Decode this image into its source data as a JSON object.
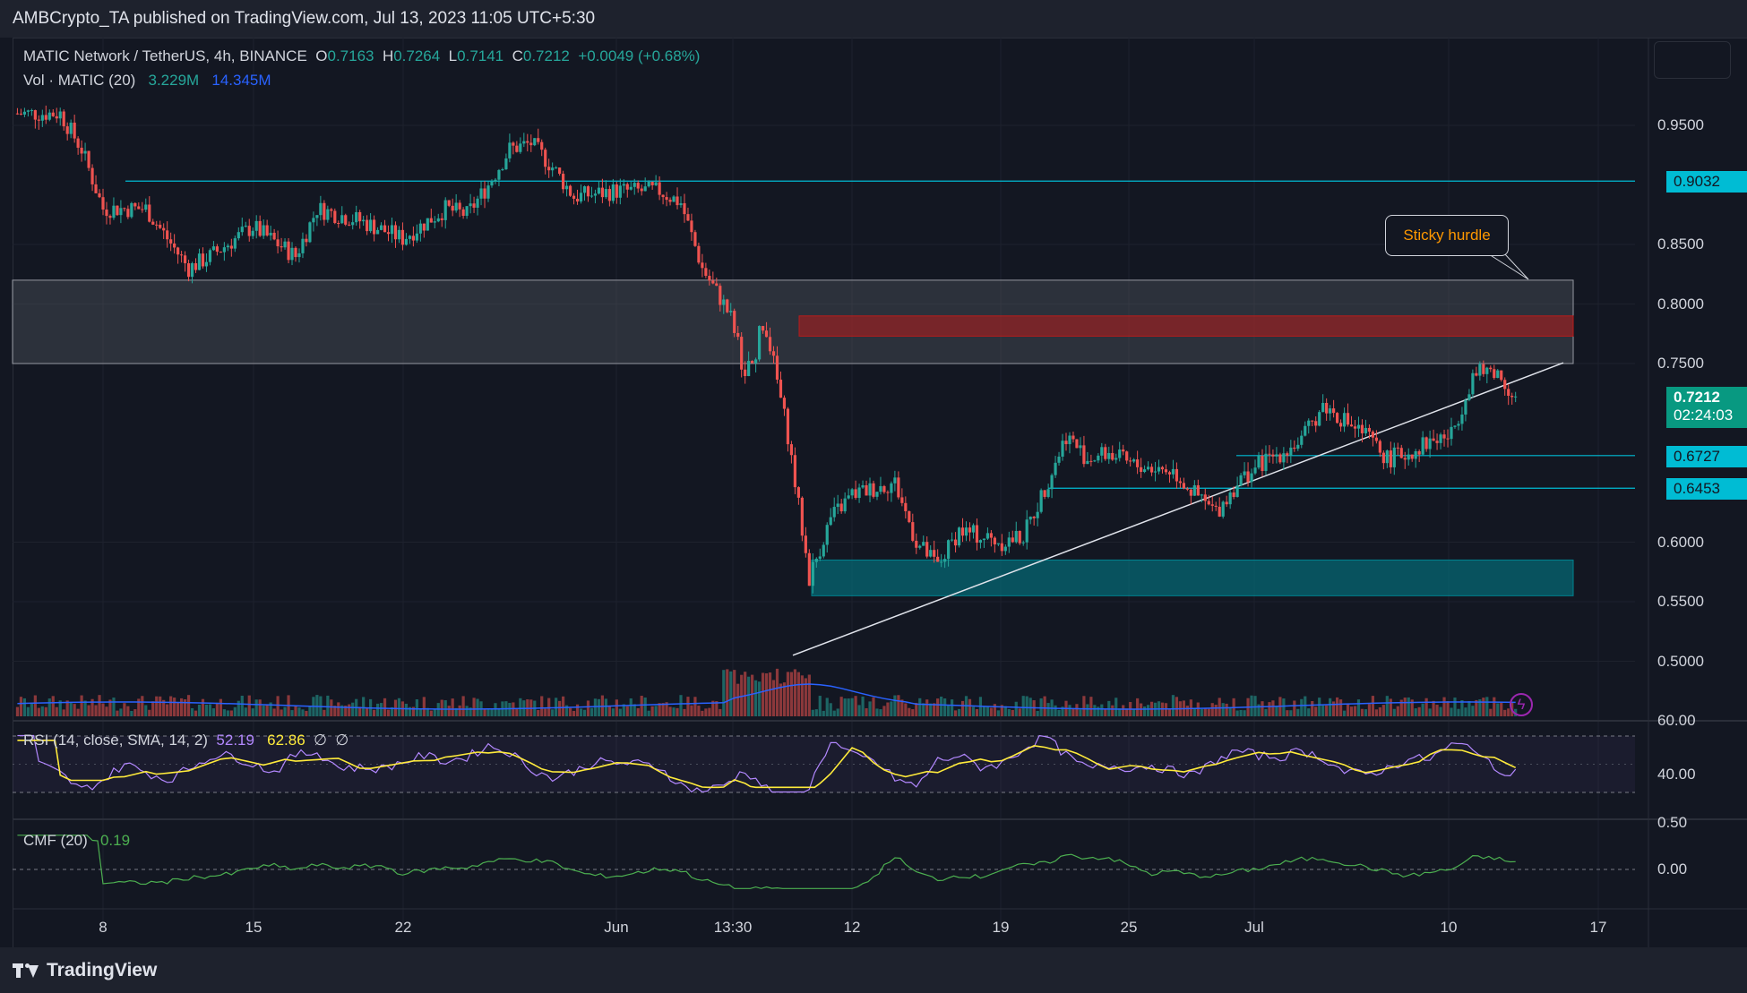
{
  "header": {
    "publisher_text": "AMBCrypto_TA published on TradingView.com, Jul 13, 2023 11:05 UTC+5:30"
  },
  "legend": {
    "symbol": "MATIC Network / TetherUS, 4h, BINANCE",
    "o_label": "O",
    "o_value": "0.7163",
    "h_label": "H",
    "h_value": "0.7264",
    "l_label": "L",
    "l_value": "0.7141",
    "c_label": "C",
    "c_value": "0.7212",
    "change": "+0.0049 (+0.68%)",
    "vol_label": "Vol · MATIC (20)",
    "vol_value": "3.229M",
    "vol_ma": "14.345M",
    "rsi_label": "RSI (14, close, SMA, 14, 2)",
    "rsi_value": "52.19",
    "rsi_sma": "62.86",
    "rsi_extra1": "∅",
    "rsi_extra2": "∅",
    "cmf_label": "CMF (20)",
    "cmf_value": "0.19"
  },
  "price_scale": {
    "ticks": [
      "0.9500",
      "0.8500",
      "0.8000",
      "0.7500",
      "0.6000",
      "0.5500",
      "0.5000"
    ],
    "tags": [
      {
        "text": "0.9032",
        "color": "#00bcd4"
      },
      {
        "text": "0.6727",
        "color": "#00bcd4"
      },
      {
        "text": "0.6453",
        "color": "#00bcd4"
      }
    ],
    "current_price": "0.7212",
    "countdown": "02:24:03",
    "current_color": "#089981"
  },
  "rsi_scale": {
    "ticks": [
      "60.00",
      "40.00"
    ]
  },
  "cmf_scale": {
    "ticks": [
      "0.50",
      "0.00"
    ]
  },
  "time_axis": {
    "labels": [
      "8",
      "15",
      "22",
      "Jun",
      "13:30",
      "12",
      "19",
      "25",
      "Jul",
      "10",
      "17"
    ]
  },
  "annotation": {
    "text": "Sticky hurdle"
  },
  "footer": {
    "brand": "TradingView"
  },
  "chart_data": {
    "type": "candlestick",
    "symbol": "MATICUSDT",
    "timeframe": "4h",
    "ylim": [
      0.48,
      0.98
    ],
    "levels": [
      0.9032,
      0.6727,
      0.6453
    ],
    "zones": [
      {
        "name": "supply",
        "from": 0.75,
        "to": 0.82,
        "color": "#5d606b"
      },
      {
        "name": "order-block",
        "from": 0.773,
        "to": 0.79,
        "color": "#b71c1c"
      },
      {
        "name": "demand",
        "from": 0.555,
        "to": 0.585,
        "color": "#00838f"
      }
    ],
    "trendline": {
      "from": {
        "date": "Jun 9",
        "price": 0.505
      },
      "to": {
        "date": "Jul 12",
        "price": 0.707
      }
    },
    "close_path": [
      {
        "date": "May 4",
        "price": 0.96
      },
      {
        "date": "May 6",
        "price": 0.96
      },
      {
        "date": "May 7",
        "price": 0.93
      },
      {
        "date": "May 8",
        "price": 0.88
      },
      {
        "date": "May 10",
        "price": 0.88
      },
      {
        "date": "May 12",
        "price": 0.83
      },
      {
        "date": "May 13",
        "price": 0.84
      },
      {
        "date": "May 15",
        "price": 0.865
      },
      {
        "date": "May 17",
        "price": 0.84
      },
      {
        "date": "May 18",
        "price": 0.88
      },
      {
        "date": "May 20",
        "price": 0.87
      },
      {
        "date": "May 22",
        "price": 0.855
      },
      {
        "date": "May 24",
        "price": 0.88
      },
      {
        "date": "May 25",
        "price": 0.875
      },
      {
        "date": "May 26",
        "price": 0.9
      },
      {
        "date": "May 27",
        "price": 0.93
      },
      {
        "date": "May 28",
        "price": 0.935
      },
      {
        "date": "May 29",
        "price": 0.915
      },
      {
        "date": "May 30",
        "price": 0.89
      },
      {
        "date": "Jun 1",
        "price": 0.895
      },
      {
        "date": "Jun 3",
        "price": 0.895
      },
      {
        "date": "Jun 4",
        "price": 0.885
      },
      {
        "date": "Jun 5",
        "price": 0.83
      },
      {
        "date": "Jun 6",
        "price": 0.8
      },
      {
        "date": "Jun 7",
        "price": 0.765
      },
      {
        "date": "Jun 8",
        "price": 0.78
      },
      {
        "date": "Jun 9",
        "price": 0.69
      },
      {
        "date": "Jun 10",
        "price": 0.57
      },
      {
        "date": "Jun 11",
        "price": 0.62
      },
      {
        "date": "Jun 12",
        "price": 0.64
      },
      {
        "date": "Jun 14",
        "price": 0.65
      },
      {
        "date": "Jun 15",
        "price": 0.6
      },
      {
        "date": "Jun 16",
        "price": 0.58
      },
      {
        "date": "Jun 17",
        "price": 0.61
      },
      {
        "date": "Jun 19",
        "price": 0.6
      },
      {
        "date": "Jun 20",
        "price": 0.605
      },
      {
        "date": "Jun 21",
        "price": 0.645
      },
      {
        "date": "Jun 22",
        "price": 0.69
      },
      {
        "date": "Jun 23",
        "price": 0.67
      },
      {
        "date": "Jun 24",
        "price": 0.675
      },
      {
        "date": "Jun 25",
        "price": 0.665
      },
      {
        "date": "Jun 27",
        "price": 0.66
      },
      {
        "date": "Jun 28",
        "price": 0.64
      },
      {
        "date": "Jun 29",
        "price": 0.625
      },
      {
        "date": "Jun 30",
        "price": 0.65
      },
      {
        "date": "Jul 1",
        "price": 0.665
      },
      {
        "date": "Jul 3",
        "price": 0.685
      },
      {
        "date": "Jul 4",
        "price": 0.715
      },
      {
        "date": "Jul 6",
        "price": 0.69
      },
      {
        "date": "Jul 7",
        "price": 0.67
      },
      {
        "date": "Jul 8",
        "price": 0.675
      },
      {
        "date": "Jul 9",
        "price": 0.685
      },
      {
        "date": "Jul 10",
        "price": 0.69
      },
      {
        "date": "Jul 11",
        "price": 0.74
      },
      {
        "date": "Jul 12",
        "price": 0.745
      },
      {
        "date": "Jul 13",
        "price": 0.7212
      }
    ],
    "rsi": {
      "ylim": [
        20,
        80
      ],
      "bands": [
        70,
        30
      ],
      "mid": 50,
      "last": 52.19,
      "sma_last": 62.86
    },
    "cmf": {
      "ylim": [
        -0.3,
        0.6
      ],
      "last": 0.19
    }
  }
}
